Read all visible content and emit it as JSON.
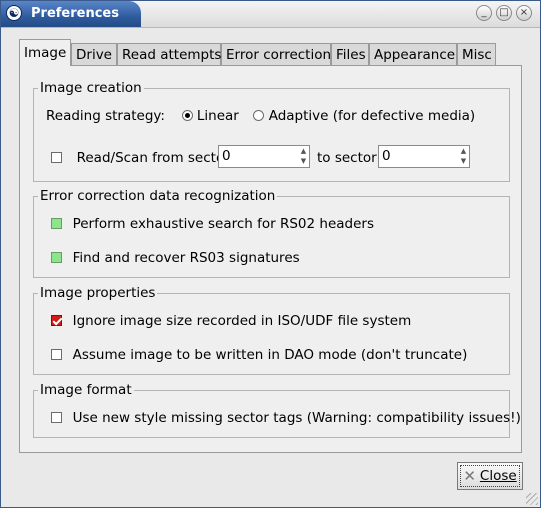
{
  "window": {
    "title": "Preferences",
    "controls": {
      "minimize": "_",
      "maximize": "□",
      "close": "×"
    }
  },
  "tabs": [
    {
      "label": "Image"
    },
    {
      "label": "Drive"
    },
    {
      "label": "Read attempts"
    },
    {
      "label": "Error correction"
    },
    {
      "label": "Files"
    },
    {
      "label": "Appearance"
    },
    {
      "label": "Misc"
    }
  ],
  "image_creation": {
    "title": "Image creation",
    "strategy_label": "Reading strategy:",
    "linear_label": "Linear",
    "adaptive_label": "Adaptive (for defective media)",
    "selected_strategy": "Linear",
    "read_scan_label": "Read/Scan from sector",
    "from_sector": "0",
    "to_sector_label": "to sector",
    "to_sector": "0"
  },
  "ecc_recognition": {
    "title": "Error correction data recognization",
    "rs02_label": "Perform exhaustive search for RS02 headers",
    "rs03_label": "Find and recover RS03 signatures"
  },
  "image_properties": {
    "title": "Image properties",
    "ignore_size_label": "Ignore image size recorded in ISO/UDF file system",
    "dao_label": "Assume image to be written in DAO mode (don't truncate)"
  },
  "image_format": {
    "title": "Image format",
    "new_style_label": "Use new style missing sector tags (Warning: compatibility issues!)"
  },
  "footer": {
    "close_label": "Close"
  }
}
